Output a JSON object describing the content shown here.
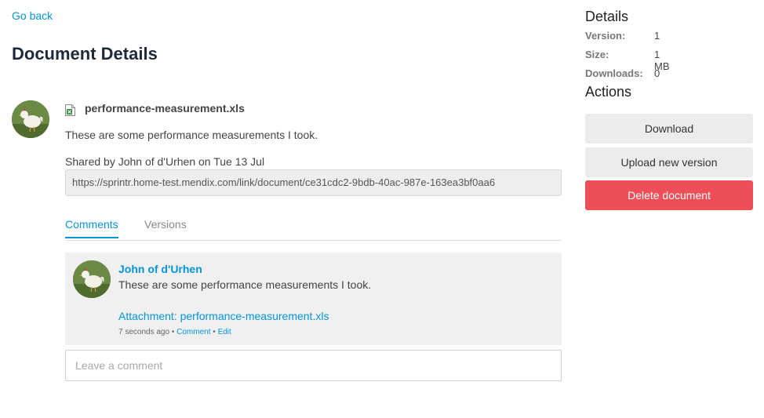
{
  "nav": {
    "go_back": "Go back"
  },
  "page": {
    "title": "Document Details"
  },
  "document": {
    "file_name": "performance-measurement.xls",
    "description": "These are some performance measurements I took.",
    "shared_line": "Shared by John of d'Urhen on Tue 13 Jul",
    "share_url": "https://sprintr.home-test.mendix.com/link/document/ce31cdc2-9bdb-40ac-987e-163ea3bf0aa6"
  },
  "tabs": [
    {
      "label": "Comments",
      "active": true
    },
    {
      "label": "Versions",
      "active": false
    }
  ],
  "comment": {
    "author": "John of d'Urhen",
    "text": "These are some performance measurements I took.",
    "attachment": "Attachment: performance-measurement.xls",
    "time": "7 seconds ago",
    "separator": "•",
    "comment_link": "Comment",
    "edit_link": "Edit"
  },
  "comment_input": {
    "placeholder": "Leave a comment"
  },
  "details": {
    "title": "Details",
    "version_label": "Version:",
    "version_value": "1",
    "size_label": "Size:",
    "size_value": "1 MB",
    "downloads_label": "Downloads:",
    "downloads_value": "0"
  },
  "actions": {
    "title": "Actions",
    "download": "Download",
    "upload": "Upload new version",
    "delete": "Delete document"
  },
  "colors": {
    "accent": "#0595db",
    "danger": "#ed4f58",
    "button_bg": "#ececec"
  },
  "icons": {
    "file": "excel-file-icon",
    "avatar": "chicken-avatar"
  }
}
